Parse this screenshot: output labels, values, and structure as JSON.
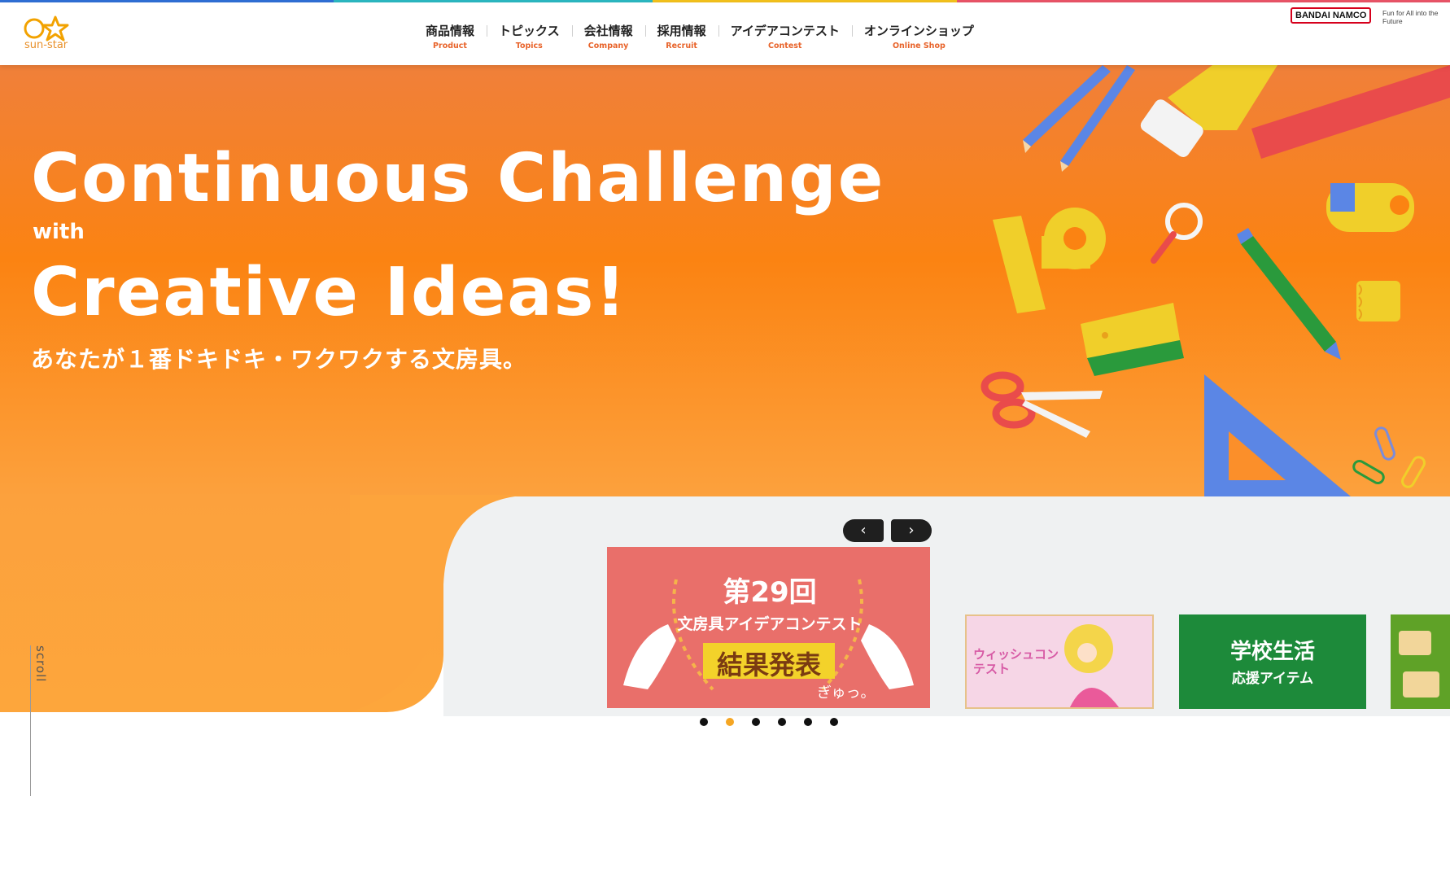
{
  "brand": {
    "logo_text": "sun-star",
    "corp_logo_text": "BANDAI NAMCO",
    "corp_tagline": "Fun for All into the Future"
  },
  "nav": [
    {
      "jp": "商品情報",
      "en": "Product"
    },
    {
      "jp": "トピックス",
      "en": "Topics"
    },
    {
      "jp": "会社情報",
      "en": "Company"
    },
    {
      "jp": "採用情報",
      "en": "Recruit"
    },
    {
      "jp": "アイデアコンテスト",
      "en": "Contest"
    },
    {
      "jp": "オンラインショップ",
      "en": "Online Shop"
    }
  ],
  "hero": {
    "line1": "Continuous Challenge",
    "with": "with",
    "line2": "Creative Ideas!",
    "subtitle": "あなたが１番ドキドキ・ワクワクする文房具。"
  },
  "slider": {
    "prev_label": "‹",
    "next_label": "›",
    "main_slide": {
      "edition": "第29回",
      "title": "文房具アイデアコンテスト",
      "headline": "結果発表",
      "tag": "ぎゅっ。"
    },
    "slide_2": {
      "title": "ウィッシュコンテスト"
    },
    "slide_3": {
      "title": "学校生活",
      "subtitle": "応援アイテム"
    },
    "dot_count": 6,
    "active_dot": 1
  },
  "scroll": {
    "label": "scroll"
  },
  "colors": {
    "accent_orange": "#fb8312",
    "nav_en": "#e8632a",
    "grey_bg": "#eff1f2",
    "slide_red": "#e96f6a",
    "slide_green": "#1d8a3a"
  }
}
